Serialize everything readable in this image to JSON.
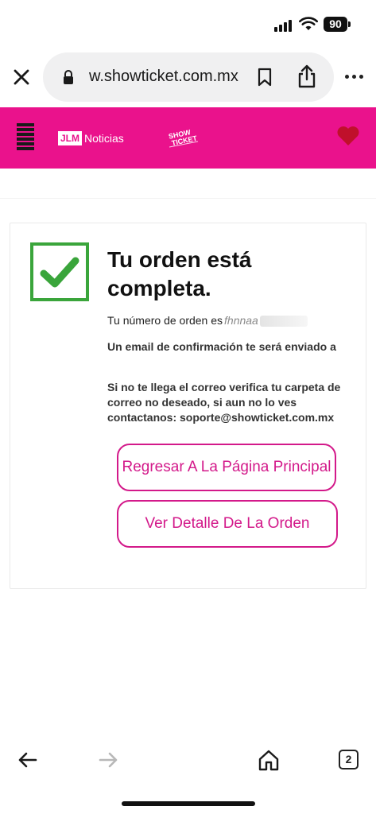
{
  "status_bar": {
    "battery": "90"
  },
  "browser": {
    "url": "w.showticket.com.mx",
    "open_tabs": "2"
  },
  "site_header": {
    "logo_jlm_box": "JLM",
    "logo_jlm_text": "Noticias",
    "logo_show": "SHOW TICKET"
  },
  "order": {
    "title": "Tu orden está completa.",
    "number_label": "Tu número de orden es",
    "number_value": "fhnnaa",
    "email_notice": "Un email de confirmación te será enviado a",
    "spam_notice": "Si no te llega el correo verifica tu carpeta de correo no deseado, si aun no lo ves contactanos: soporte@showticket.com.mx",
    "home_button": "Regresar A La Página Principal",
    "detail_button": "Ver Detalle De La Orden"
  },
  "colors": {
    "brand_pink": "#ea128c",
    "button_pink": "#d3198a",
    "check_green": "#3aa53b"
  }
}
